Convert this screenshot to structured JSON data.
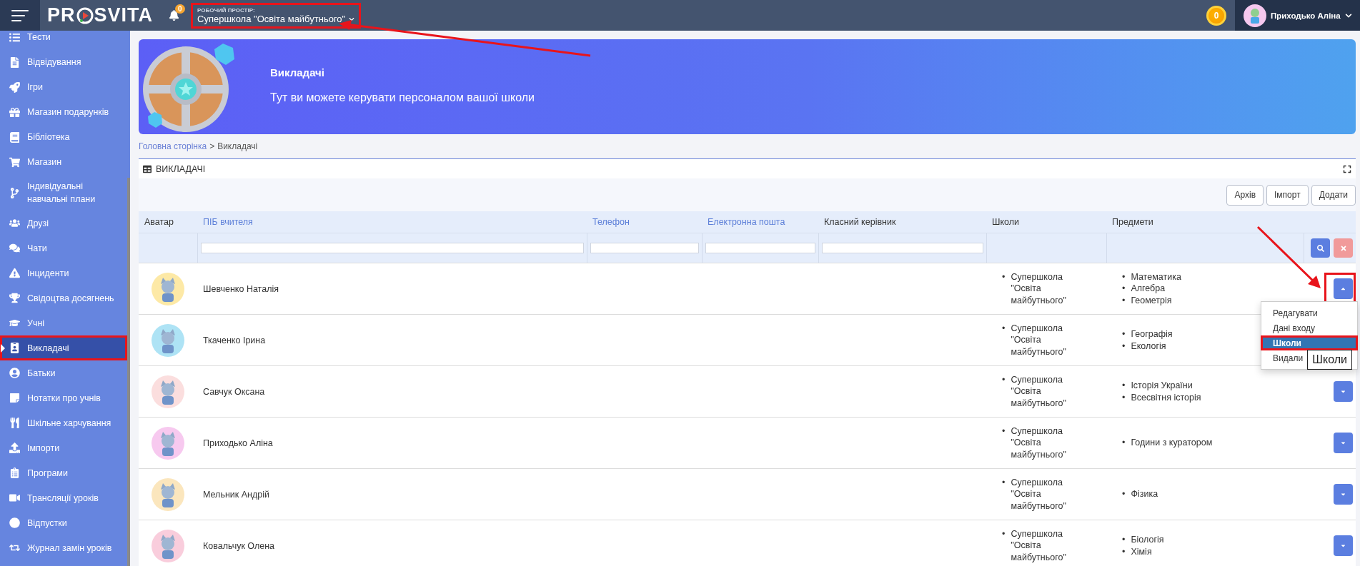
{
  "topbar": {
    "logo": [
      "PR",
      "SVITA"
    ],
    "notifications": "0",
    "workspace": {
      "label": "РОБОЧИЙ ПРОСТІР:",
      "value": "Супершкола \"Освіта майбутнього\"",
      "annotated": true
    },
    "coins": "0",
    "user": "Приходько Аліна"
  },
  "sidebar": {
    "items": [
      {
        "label": "Тести",
        "selected": false,
        "annotated": false
      },
      {
        "label": "Відвідування",
        "selected": false,
        "annotated": false
      },
      {
        "label": "Ігри",
        "selected": false,
        "annotated": false
      },
      {
        "label": "Магазин подарунків",
        "selected": false,
        "annotated": false
      },
      {
        "label": "Бібліотека",
        "selected": false,
        "annotated": false
      },
      {
        "label": "Магазин",
        "selected": false,
        "annotated": false
      },
      {
        "label": "Індивідуальні навчальні плани",
        "selected": false,
        "annotated": false
      },
      {
        "label": "Друзі",
        "selected": false,
        "annotated": false
      },
      {
        "label": "Чати",
        "selected": false,
        "annotated": false
      },
      {
        "label": "Інциденти",
        "selected": false,
        "annotated": false
      },
      {
        "label": "Свідоцтва досягнень",
        "selected": false,
        "annotated": false
      },
      {
        "label": "Учні",
        "selected": false,
        "annotated": false
      },
      {
        "label": "Викладачі",
        "selected": true,
        "annotated": true
      },
      {
        "label": "Батьки",
        "selected": false,
        "annotated": false
      },
      {
        "label": "Нотатки про учнів",
        "selected": false,
        "annotated": false
      },
      {
        "label": "Шкільне харчування",
        "selected": false,
        "annotated": false
      },
      {
        "label": "Імпорти",
        "selected": false,
        "annotated": false
      },
      {
        "label": "Програми",
        "selected": false,
        "annotated": false
      },
      {
        "label": "Трансляції уроків",
        "selected": false,
        "annotated": false
      },
      {
        "label": "Відпустки",
        "selected": false,
        "annotated": false
      },
      {
        "label": "Журнал замін уроків",
        "selected": false,
        "annotated": false
      }
    ]
  },
  "banner": {
    "title": "Викладачі",
    "description": "Тут ви можете керувати персоналом вашої школи"
  },
  "breadcrumb": {
    "items": [
      "Головна сторінка",
      "Викладачі"
    ],
    "separator": ">"
  },
  "panel": {
    "title": "ВИКЛАДАЧІ",
    "buttons": [
      "Архів",
      "Імпорт",
      "Додати"
    ]
  },
  "table": {
    "columns": [
      {
        "label": "Аватар",
        "sortable": false,
        "filter": false
      },
      {
        "label": "ПІБ вчителя",
        "sortable": true,
        "filter": true
      },
      {
        "label": "Телефон",
        "sortable": true,
        "filter": true
      },
      {
        "label": "Електронна пошта",
        "sortable": true,
        "filter": true
      },
      {
        "label": "Класний керівник",
        "sortable": false,
        "filter": true
      },
      {
        "label": "Школи",
        "sortable": false,
        "filter": false
      },
      {
        "label": "Предмети",
        "sortable": false,
        "filter": false
      }
    ],
    "bullet": "•",
    "rows": [
      {
        "name": "Шевченко Наталія",
        "schools": [
          "Супершкола \"Освіта майбутнього\""
        ],
        "subjects": [
          "Математика",
          "Алгебра",
          "Геометрія"
        ],
        "color": "#fde9a6",
        "expanded": true,
        "annotated": true
      },
      {
        "name": "Ткаченко Ірина",
        "schools": [
          "Супершкола \"Освіта майбутнього\""
        ],
        "subjects": [
          "Географія",
          "Екологія"
        ],
        "color": "#aee3f5",
        "expanded": false,
        "annotated": false
      },
      {
        "name": "Савчук Оксана",
        "schools": [
          "Супершкола \"Освіта майбутнього\""
        ],
        "subjects": [
          "Історія України",
          "Всесвітня історія"
        ],
        "color": "#fbdede",
        "expanded": false,
        "annotated": false
      },
      {
        "name": "Приходько Аліна",
        "schools": [
          "Супершкола \"Освіта майбутнього\""
        ],
        "subjects": [
          "Години з куратором"
        ],
        "color": "#f7c9ef",
        "expanded": false,
        "annotated": false
      },
      {
        "name": "Мельник Андрій",
        "schools": [
          "Супершкола \"Освіта майбутнього\""
        ],
        "subjects": [
          "Фізика"
        ],
        "color": "#fbe6bd",
        "expanded": false,
        "annotated": false
      },
      {
        "name": "Ковальчук Олена",
        "schools": [
          "Супершкола \"Освіта майбутнього\""
        ],
        "subjects": [
          "Біологія",
          "Хімія"
        ],
        "color": "#f9cddc",
        "expanded": false,
        "annotated": false
      }
    ]
  },
  "row_menu": {
    "items": [
      {
        "label": "Редагувати",
        "selected": false,
        "annotated": false
      },
      {
        "label": "Дані входу",
        "selected": false,
        "annotated": false
      },
      {
        "label": "Школи",
        "selected": true,
        "annotated": true
      },
      {
        "label": "Видали",
        "selected": false,
        "annotated": false
      }
    ],
    "tooltip": "Школи"
  }
}
